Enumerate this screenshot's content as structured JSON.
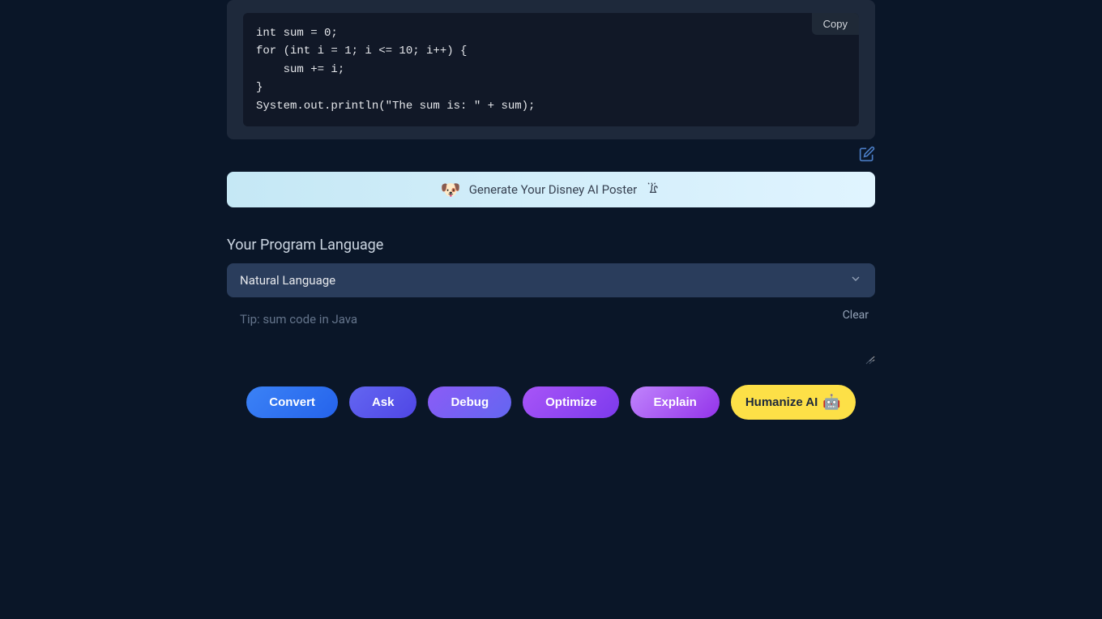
{
  "code_response": {
    "code": "int sum = 0;\nfor (int i = 1; i <= 10; i++) {\n    sum += i;\n}\nSystem.out.println(\"The sum is: \" + sum);",
    "copy_label": "Copy"
  },
  "promo": {
    "emoji": "🐶",
    "text": "Generate Your Disney AI Poster"
  },
  "language": {
    "label": "Your Program Language",
    "selected": "Natural Language"
  },
  "input": {
    "placeholder": "Tip: sum code in Java",
    "clear_label": "Clear"
  },
  "actions": {
    "convert": "Convert",
    "ask": "Ask",
    "debug": "Debug",
    "optimize": "Optimize",
    "explain": "Explain",
    "humanize": "Humanize AI",
    "humanize_emoji": "🤖"
  }
}
